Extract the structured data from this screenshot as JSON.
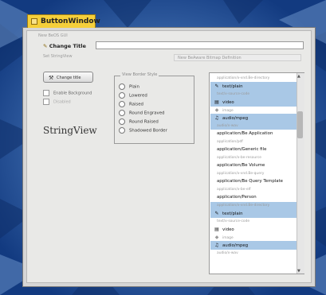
{
  "window": {
    "title": "ButtonWindow"
  },
  "group": {
    "label": "New BeOS GUI"
  },
  "title_row": {
    "label": "Change Title",
    "value": ""
  },
  "stringview_row": {
    "label": "Set StringView",
    "value": "New BeAware Bitmap Definition"
  },
  "change_button": {
    "label": "Change title"
  },
  "checkboxes": [
    {
      "label": "Enable Background"
    },
    {
      "label": "Disabled"
    }
  ],
  "stringview_text": "StringView",
  "border_group": {
    "label": "View Border Style",
    "options": [
      "Plain",
      "Lowered",
      "Raised",
      "Round Engraved",
      "Round Raised",
      "Shadowed Border"
    ]
  },
  "file_list": [
    {
      "label": "application/x-vnd.Be-directory",
      "kind": "mime",
      "icon": "",
      "sel": false
    },
    {
      "label": "text/plain",
      "kind": "item",
      "icon": "text-file-icon",
      "sel": true
    },
    {
      "label": "text/x-source-code",
      "kind": "mime",
      "icon": "",
      "sel": true
    },
    {
      "label": "video",
      "kind": "item",
      "icon": "video-icon",
      "sel": true
    },
    {
      "label": "image",
      "kind": "mime",
      "icon": "image-icon",
      "sel": false
    },
    {
      "label": "audio/mpeg",
      "kind": "item",
      "icon": "audio-icon",
      "sel": true
    },
    {
      "label": "audio/x-wav",
      "kind": "mime",
      "icon": "",
      "sel": true
    },
    {
      "label": "application/Be Application",
      "kind": "item",
      "icon": "",
      "sel": false
    },
    {
      "label": "application/pdf",
      "kind": "mime",
      "icon": "",
      "sel": false
    },
    {
      "label": "application/Generic file",
      "kind": "item",
      "icon": "",
      "sel": false
    },
    {
      "label": "application/x-be-resource",
      "kind": "mime",
      "icon": "",
      "sel": false
    },
    {
      "label": "application/Be Volume",
      "kind": "item",
      "icon": "",
      "sel": false
    },
    {
      "label": "application/x-vnd.Be-query",
      "kind": "mime",
      "icon": "",
      "sel": false
    },
    {
      "label": "application/Be Query Template",
      "kind": "item",
      "icon": "",
      "sel": false
    },
    {
      "label": "application/x-be-elf",
      "kind": "mime",
      "icon": "",
      "sel": false
    },
    {
      "label": "application/Person",
      "kind": "item",
      "icon": "",
      "sel": false
    },
    {
      "label": "application/x-vnd.Be-directory",
      "kind": "mime",
      "icon": "",
      "sel": true
    },
    {
      "label": "text/plain",
      "kind": "item",
      "icon": "text-file-icon",
      "sel": true
    },
    {
      "label": "text/x-source-code",
      "kind": "mime",
      "icon": "",
      "sel": false
    },
    {
      "label": "video",
      "kind": "item",
      "icon": "video-icon",
      "sel": false
    },
    {
      "label": "image",
      "kind": "mime",
      "icon": "image-icon",
      "sel": false
    },
    {
      "label": "audio/mpeg",
      "kind": "item",
      "icon": "audio-icon",
      "sel": true
    },
    {
      "label": "audio/x-wav",
      "kind": "mime",
      "icon": "",
      "sel": false
    }
  ],
  "colors": {
    "tab": "#f5cf3a",
    "selection": "#a9c8e6",
    "desktop": "#1e4a96"
  }
}
